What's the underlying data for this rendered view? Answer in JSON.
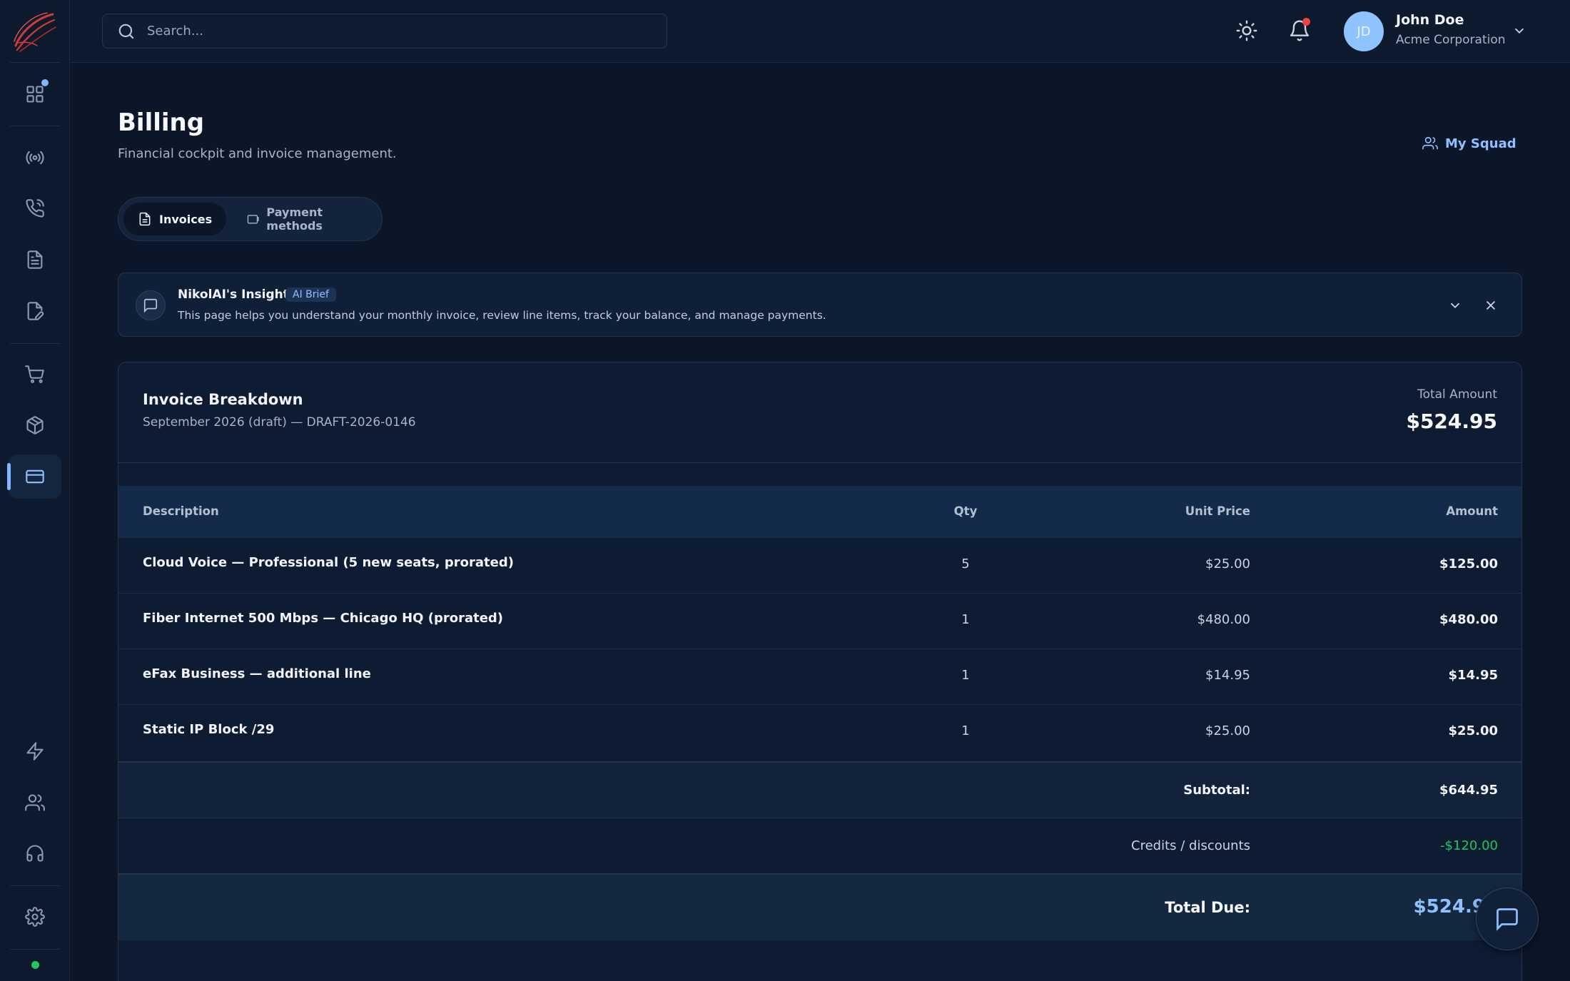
{
  "header": {
    "search_placeholder": "Search...",
    "user": {
      "initials": "JD",
      "name": "John Doe",
      "org": "Acme Corporation"
    }
  },
  "sidebar": {
    "items": [
      {
        "name": "dashboard",
        "icon": "grid-icon"
      },
      {
        "name": "broadcast",
        "icon": "broadcast-icon"
      },
      {
        "name": "calls",
        "icon": "phone-icon"
      },
      {
        "name": "documents",
        "icon": "document-icon"
      },
      {
        "name": "edit",
        "icon": "edit-document-icon"
      },
      {
        "name": "cart",
        "icon": "cart-icon"
      },
      {
        "name": "products",
        "icon": "package-icon"
      },
      {
        "name": "billing",
        "icon": "credit-card-icon",
        "active": true
      },
      {
        "name": "automation",
        "icon": "lightning-icon"
      },
      {
        "name": "team",
        "icon": "users-icon"
      },
      {
        "name": "support",
        "icon": "headphones-icon"
      },
      {
        "name": "settings",
        "icon": "gear-icon"
      }
    ]
  },
  "page": {
    "title": "Billing",
    "subtitle": "Financial cockpit and invoice management.",
    "squad_label": "My Squad"
  },
  "tabs": [
    {
      "label": "Invoices",
      "active": true
    },
    {
      "label": "Payment methods",
      "active": false
    }
  ],
  "insight": {
    "title": "NikolAI's Insight",
    "badge": "AI Brief",
    "text": "This page helps you understand your monthly invoice, review line items, track your balance, and manage payments."
  },
  "invoice": {
    "title": "Invoice Breakdown",
    "subtitle": "September 2026 (draft) — DRAFT-2026-0146",
    "total_label": "Total Amount",
    "total_value": "$524.95",
    "columns": [
      "Description",
      "Qty",
      "Unit Price",
      "Amount"
    ],
    "rows": [
      {
        "description": "Cloud Voice — Professional (5 new seats, prorated)",
        "qty": "5",
        "unit": "$25.00",
        "amount": "$125.00"
      },
      {
        "description": "Fiber Internet 500 Mbps — Chicago HQ (prorated)",
        "qty": "1",
        "unit": "$480.00",
        "amount": "$480.00"
      },
      {
        "description": "eFax Business — additional line",
        "qty": "1",
        "unit": "$14.95",
        "amount": "$14.95"
      },
      {
        "description": "Static IP Block /29",
        "qty": "1",
        "unit": "$25.00",
        "amount": "$25.00"
      }
    ],
    "subtotal_label": "Subtotal:",
    "subtotal_value": "$644.95",
    "credits_label": "Credits / discounts",
    "credits_value": "-$120.00",
    "total_due_label": "Total Due:",
    "total_due_value": "$524.95"
  },
  "colors": {
    "accent": "#8fc0ff",
    "credit_green": "#22c55e",
    "alert_red": "#ef4444"
  }
}
